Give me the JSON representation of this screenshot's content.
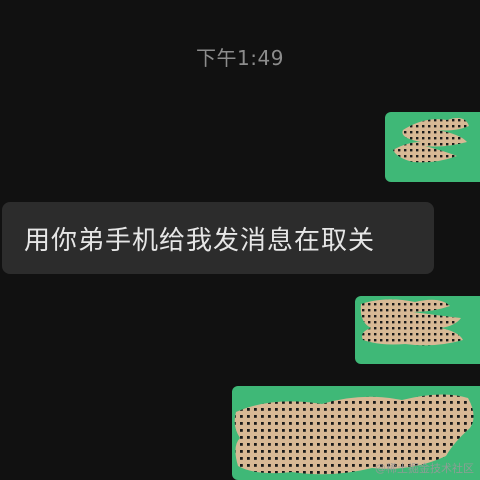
{
  "conversation": {
    "timestamp": "下午1:49",
    "messages": [
      {
        "side": "right",
        "content": "redacted"
      },
      {
        "side": "left",
        "text": "用你弟手机给我发消息在取关"
      },
      {
        "side": "right",
        "content": "redacted"
      },
      {
        "side": "right",
        "content": "redacted"
      }
    ]
  },
  "watermark": "@稀土掘金技术社区",
  "colors": {
    "background": "#111111",
    "incoming_bubble": "#2c2c2c",
    "outgoing_bubble": "#3fb877",
    "redaction_tan": "#d8b995",
    "redaction_dots": "#1a1a1a"
  }
}
